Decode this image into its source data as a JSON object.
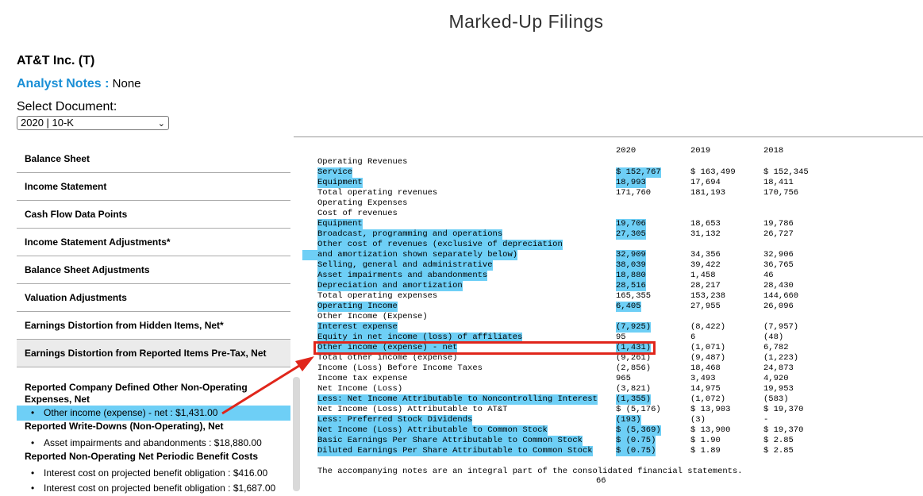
{
  "page_title": "Marked-Up Filings",
  "company": "AT&T Inc. (T)",
  "analyst_notes": {
    "label": "Analyst Notes :",
    "value": "None"
  },
  "select_document": {
    "label": "Select Document:",
    "value": "2020 | 10-K"
  },
  "nav": [
    "Balance Sheet",
    "Income Statement",
    "Cash Flow Data Points",
    "Income Statement Adjustments*",
    "Balance Sheet Adjustments",
    "Valuation Adjustments",
    "Earnings Distortion from Hidden Items, Net*",
    "Earnings Distortion from Reported Items Pre-Tax, Net"
  ],
  "details": {
    "group1_title": "Reported Company Defined Other Non-Operating Expenses, Net",
    "group1_item": "Other income (expense) - net : $1,431.00",
    "group2_title": "Reported Write-Downs (Non-Operating), Net",
    "group2_item": "Asset impairments and abandonments : $18,880.00",
    "group3_title": "Reported Non-Operating Net Periodic Benefit Costs",
    "group3_item1": "Interest cost on projected benefit obligation : $416.00",
    "group3_item2": "Interest cost on projected benefit obligation : $1,687.00"
  },
  "statement": {
    "years": [
      "2020",
      "2019",
      "2018"
    ],
    "rows": [
      [
        "Operating Revenues",
        "",
        "",
        ""
      ],
      [
        "Service",
        "$ 152,767",
        "$ 163,499",
        "$ 152,345"
      ],
      [
        "Equipment",
        "18,993",
        "17,694",
        "18,411"
      ],
      [
        "Total operating revenues",
        "171,760",
        "181,193",
        "170,756"
      ],
      [
        "Operating Expenses",
        "",
        "",
        ""
      ],
      [
        "Cost of revenues",
        "",
        "",
        ""
      ],
      [
        "Equipment",
        "19,706",
        "18,653",
        "19,786"
      ],
      [
        "Broadcast, programming and operations",
        "27,305",
        "31,132",
        "26,727"
      ],
      [
        "Other cost of revenues (exclusive of depreciation",
        "",
        "",
        ""
      ],
      [
        "and amortization shown separately below)",
        "32,909",
        "34,356",
        "32,906"
      ],
      [
        "Selling, general and administrative",
        "38,039",
        "39,422",
        "36,765"
      ],
      [
        "Asset impairments and abandonments",
        "18,880",
        "1,458",
        "46"
      ],
      [
        "Depreciation and amortization",
        "28,516",
        "28,217",
        "28,430"
      ],
      [
        "Total operating expenses",
        "165,355",
        "153,238",
        "144,660"
      ],
      [
        "Operating Income",
        "6,405",
        "27,955",
        "26,096"
      ],
      [
        "Other Income (Expense)",
        "",
        "",
        ""
      ],
      [
        "Interest expense",
        "(7,925)",
        "(8,422)",
        "(7,957)"
      ],
      [
        "Equity in net income (loss) of affiliates",
        "95",
        "6",
        "(48)"
      ],
      [
        "Other income (expense) - net",
        "(1,431)",
        "(1,071)",
        "6,782"
      ],
      [
        "Total other income (expense)",
        "(9,261)",
        "(9,487)",
        "(1,223)"
      ],
      [
        "Income (Loss) Before Income Taxes",
        "(2,856)",
        "18,468",
        "24,873"
      ],
      [
        "Income tax expense",
        "965",
        "3,493",
        "4,920"
      ],
      [
        "Net Income (Loss)",
        "(3,821)",
        "14,975",
        "19,953"
      ],
      [
        "Less: Net Income Attributable to Noncontrolling Interest",
        "(1,355)",
        "(1,072)",
        "(583)"
      ],
      [
        "Net Income (Loss) Attributable to AT&T",
        "$ (5,176)",
        "$ 13,903",
        "$ 19,370"
      ],
      [
        "Less: Preferred Stock Dividends",
        "(193)",
        "(3)",
        "-"
      ],
      [
        "Net Income (Loss) Attributable to Common Stock",
        "$ (5,369)",
        "$ 13,900",
        "$ 19,370"
      ],
      [
        "Basic Earnings Per Share Attributable to Common Stock",
        "$ (0.75)",
        "$ 1.90",
        "$ 2.85"
      ],
      [
        "Diluted Earnings Per Share Attributable to Common Stock",
        "$ (0.75)",
        "$ 1.89",
        "$ 2.85"
      ]
    ],
    "footnote": "The accompanying notes are an integral part of the consolidated financial statements.",
    "page_number": "66"
  },
  "colors": {
    "highlight": "#6ecff6",
    "link_blue": "#1a8fd6",
    "callout_red": "#e0261b"
  }
}
